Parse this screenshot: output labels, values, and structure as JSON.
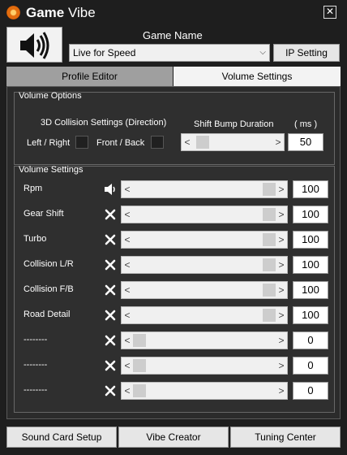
{
  "app": {
    "title_bold": "Game",
    "title_rest": " Vibe",
    "close_glyph": "✕"
  },
  "header": {
    "game_name_label": "Game Name",
    "game_select": {
      "value": "Live for Speed",
      "chevron": "⌵"
    },
    "ip_setting_label": "IP Setting"
  },
  "tabs": [
    {
      "label": "Profile Editor",
      "active": false
    },
    {
      "label": "Volume Settings",
      "active": true
    }
  ],
  "volume_options": {
    "title": "Volume Options",
    "collision_title": "3D Collision Settings (Direction)",
    "left_right_label": "Left / Right",
    "left_right_checked": false,
    "front_back_label": "Front / Back",
    "front_back_checked": false,
    "shift_bump_label": "Shift Bump Duration",
    "ms_label": "( ms )",
    "shift_bump_value": "50",
    "shift_bump_slider_level": 0.05
  },
  "volume_settings": {
    "title": "Volume Settings",
    "rows": [
      {
        "label": "Rpm",
        "icon": "speaker-icon",
        "value": "100",
        "level": 1.0
      },
      {
        "label": "Gear Shift",
        "icon": "mute-icon",
        "value": "100",
        "level": 1.0
      },
      {
        "label": "Turbo",
        "icon": "mute-icon",
        "value": "100",
        "level": 1.0
      },
      {
        "label": "Collision L/R",
        "icon": "mute-icon",
        "value": "100",
        "level": 1.0
      },
      {
        "label": "Collision F/B",
        "icon": "mute-icon",
        "value": "100",
        "level": 1.0
      },
      {
        "label": "Road Detail",
        "icon": "mute-icon",
        "value": "100",
        "level": 1.0
      },
      {
        "label": "--------",
        "icon": "mute-icon",
        "value": "0",
        "level": 0.0
      },
      {
        "label": "--------",
        "icon": "mute-icon",
        "value": "0",
        "level": 0.0
      },
      {
        "label": "--------",
        "icon": "mute-icon",
        "value": "0",
        "level": 0.0
      }
    ]
  },
  "slider_arrows": {
    "left": "<",
    "right": ">"
  },
  "footer": {
    "sound_card_setup": "Sound Card Setup",
    "vibe_creator": "Vibe Creator",
    "tuning_center": "Tuning Center"
  }
}
